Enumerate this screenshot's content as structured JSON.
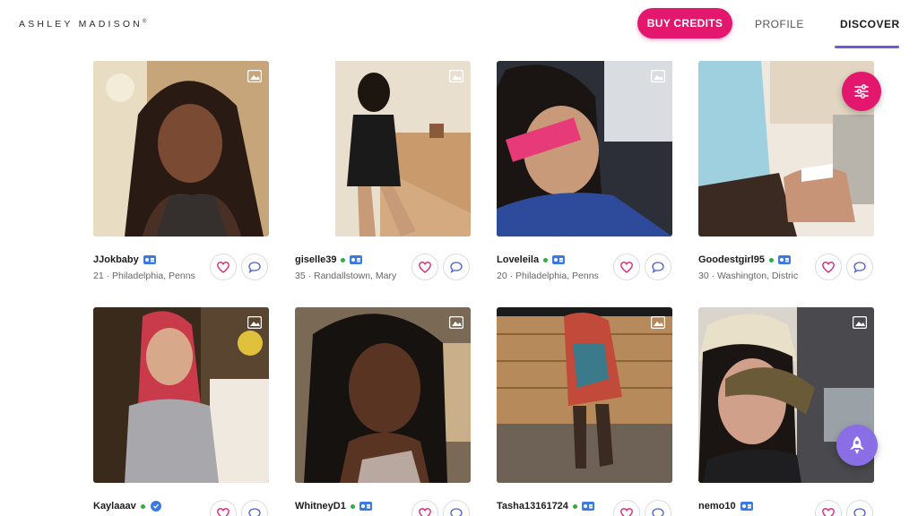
{
  "header": {
    "logo": "ASHLEY MADISON",
    "logo_mark": "®",
    "buy_credits": "BUY CREDITS",
    "nav": {
      "profile": "PROFILE",
      "discover": "DISCOVER"
    },
    "active_tab": "DISCOVER"
  },
  "colors": {
    "brand_pink": "#e3176e",
    "nav_underline": "#6b5bd6",
    "online": "#2fae3f",
    "badge_blue": "#3b7be0",
    "rocket_purple": "#8a6ee6"
  },
  "profiles": [
    {
      "username": "JJokbaby",
      "online": false,
      "badge": "id-badge",
      "info": "21 · Philadelphia, Penns"
    },
    {
      "username": "giselle39",
      "online": true,
      "badge": "id-badge",
      "info": "35 · Randallstown, Mary"
    },
    {
      "username": "Loveleila",
      "online": true,
      "badge": "id-badge",
      "info": "20 · Philadelphia, Penns"
    },
    {
      "username": "Goodestgirl95",
      "online": true,
      "badge": "id-badge",
      "info": "30 · Washington, Distric"
    },
    {
      "username": "Kaylaaav",
      "online": true,
      "badge": "verified-icon",
      "info": ""
    },
    {
      "username": "WhitneyD1",
      "online": true,
      "badge": "id-badge",
      "info": ""
    },
    {
      "username": "Tasha13161724",
      "online": true,
      "badge": "id-badge",
      "info": ""
    },
    {
      "username": "nemo10",
      "online": false,
      "badge": "id-badge",
      "info": ""
    }
  ],
  "icons": {
    "like": "heart-icon",
    "message": "chat-bubble-icon",
    "gallery": "photo-gallery-icon",
    "filter": "sliders-icon",
    "boost": "rocket-icon"
  }
}
